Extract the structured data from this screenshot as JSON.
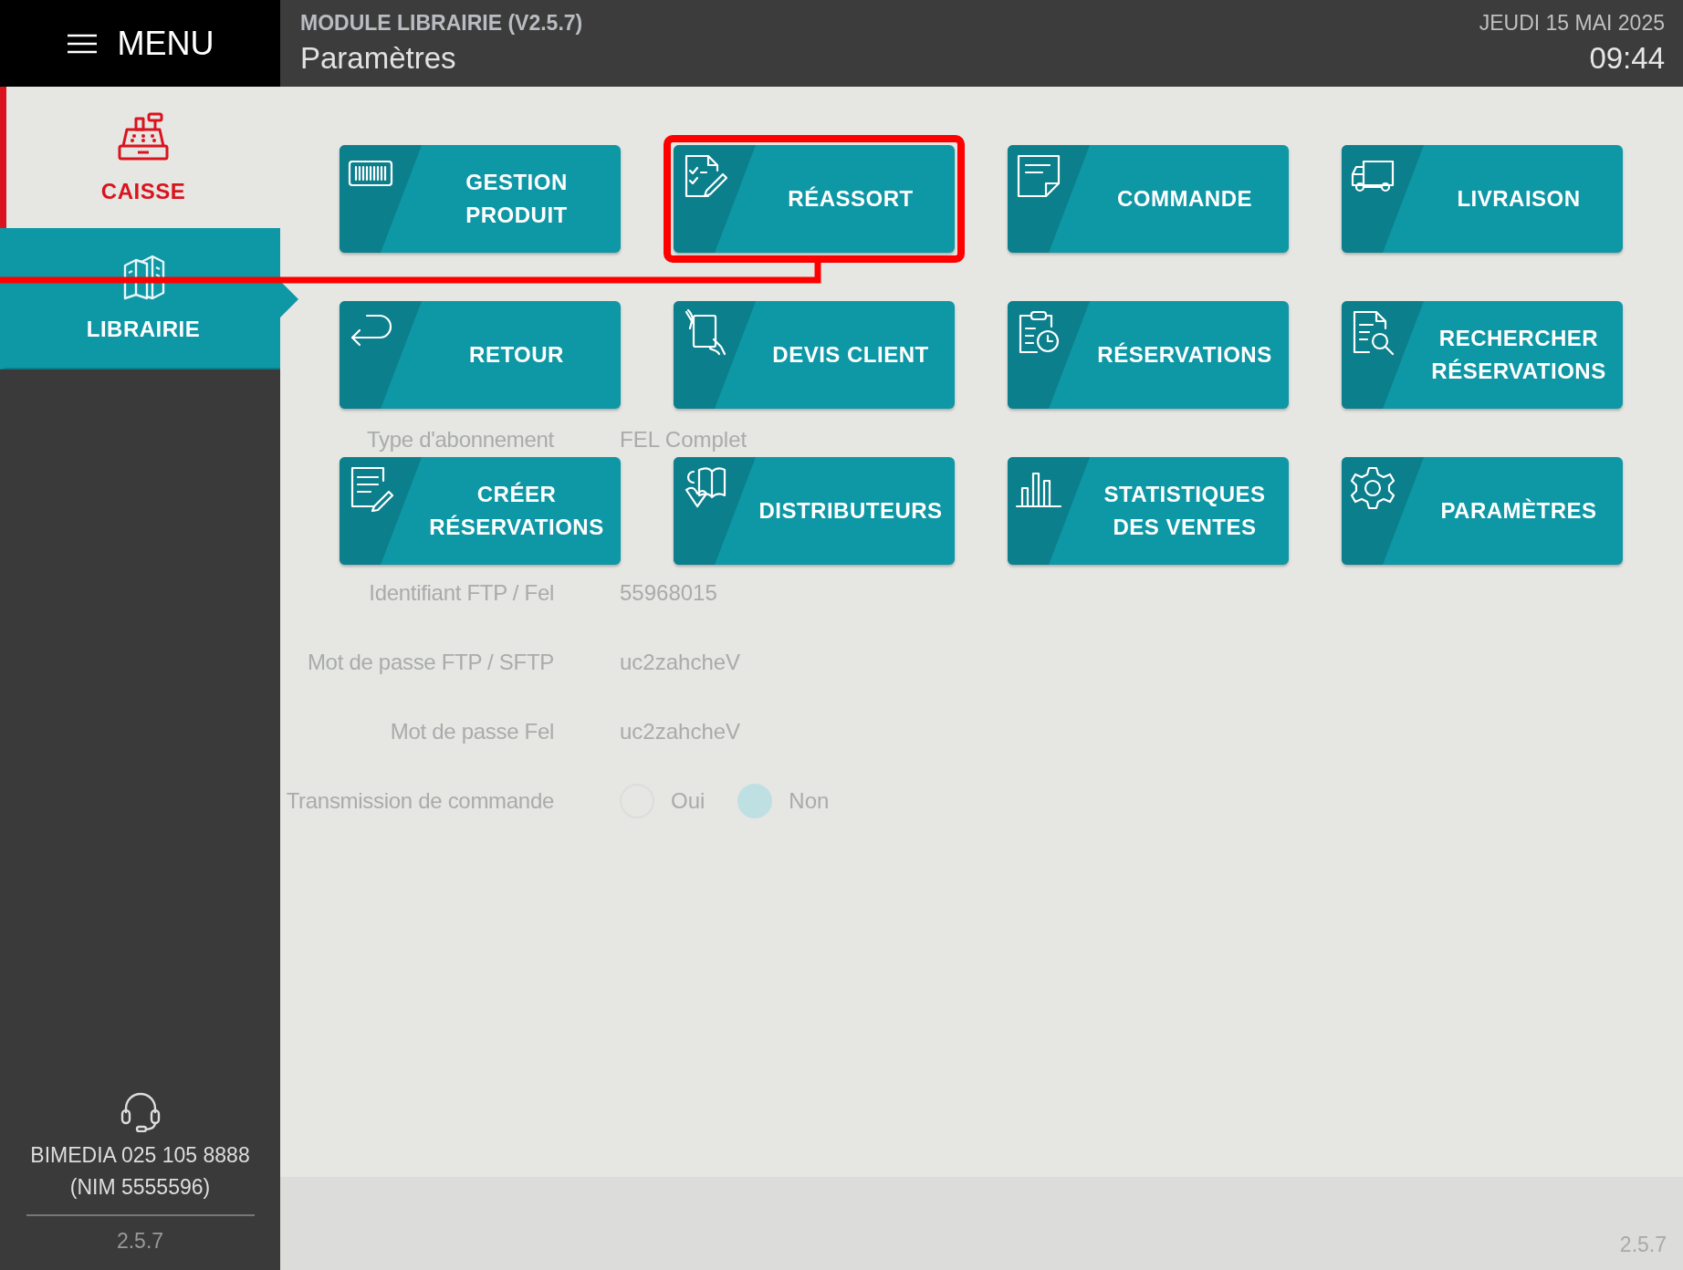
{
  "menu": {
    "label": "MENU"
  },
  "header": {
    "module": "MODULE LIBRAIRIE (V2.5.7)",
    "page_title": "Paramètres",
    "date": "JEUDI 15 MAI 2025",
    "time": "09:44"
  },
  "sidebar": {
    "items": [
      {
        "label": "CAISSE",
        "selected": false
      },
      {
        "label": "LIBRAIRIE",
        "selected": true
      }
    ],
    "support": "BIMEDIA 025 105 8888\n(NIM 5555596)",
    "version": "2.5.7"
  },
  "form": {
    "rows": [
      {
        "kind": "text",
        "label": "Type d'abonnement",
        "value": "FEL Complet"
      },
      {
        "kind": "text",
        "label": "Identifiant FTP / Fel",
        "value": "55968015"
      },
      {
        "kind": "text",
        "label": "Mot de passe FTP / SFTP",
        "value": "uc2zahcheV"
      },
      {
        "kind": "text",
        "label": "Mot de passe Fel",
        "value": "uc2zahcheV"
      },
      {
        "kind": "radio",
        "label": "Transmission de commande",
        "options": [
          {
            "label": "Oui",
            "selected": false
          },
          {
            "label": "Non",
            "selected": true
          }
        ]
      }
    ],
    "version": "2.5.7"
  },
  "tiles": [
    {
      "label": "GESTION\nPRODUIT",
      "highlighted": false
    },
    {
      "label": "RÉASSORT",
      "highlighted": true
    },
    {
      "label": "COMMANDE",
      "highlighted": false
    },
    {
      "label": "LIVRAISON",
      "highlighted": false
    },
    {
      "label": "RETOUR",
      "highlighted": false
    },
    {
      "label": "DEVIS CLIENT",
      "highlighted": false
    },
    {
      "label": "RÉSERVATIONS",
      "highlighted": false
    },
    {
      "label": "RECHERCHER\nRÉSERVATIONS",
      "highlighted": false
    },
    {
      "label": "CRÉER\nRÉSERVATIONS",
      "highlighted": false
    },
    {
      "label": "DISTRIBUTEURS",
      "highlighted": false
    },
    {
      "label": "STATISTIQUES\nDES VENTES",
      "highlighted": false
    },
    {
      "label": "PARAMÈTRES",
      "highlighted": false
    }
  ]
}
